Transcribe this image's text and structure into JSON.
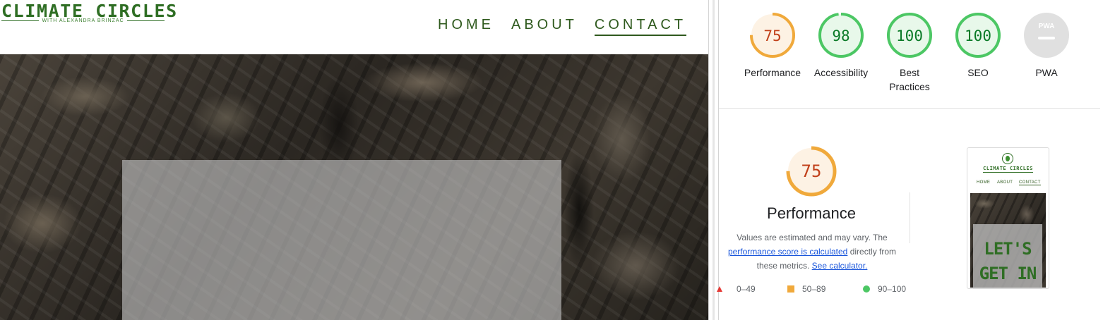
{
  "site": {
    "logo_title": "CLIMATE CIRCLES",
    "logo_subtitle": "WITH ALEXANDRA BRINZAC",
    "nav": {
      "home": "HOME",
      "about": "ABOUT",
      "contact": "CONTACT",
      "active": "contact"
    },
    "brand_color": "#2f6e24"
  },
  "report": {
    "scores": [
      {
        "label": "Performance",
        "value": "75",
        "status": "average"
      },
      {
        "label": "Accessibility",
        "value": "98",
        "status": "pass"
      },
      {
        "label": "Best Practices",
        "value": "100",
        "status": "pass"
      },
      {
        "label": "SEO",
        "value": "100",
        "status": "pass"
      },
      {
        "label": "PWA",
        "value": "",
        "status": "na"
      }
    ],
    "pwa_badge": "PWA",
    "performance": {
      "score": "75",
      "title": "Performance",
      "desc_1": "Values are estimated and may vary. The",
      "desc_link_1": "performance score is calculated",
      "desc_2": "directly from",
      "desc_3": "these metrics.",
      "desc_link_2": "See calculator."
    },
    "legend": [
      {
        "range": "0–49",
        "color": "#e53935",
        "shape": "triangle"
      },
      {
        "range": "50–89",
        "color": "#f0a93b",
        "shape": "square"
      },
      {
        "range": "90–100",
        "color": "#4cc764",
        "shape": "circle"
      }
    ],
    "colors": {
      "average": "#f0a93b",
      "average_text": "#c1401a",
      "pass": "#4cc764",
      "pass_text": "#0a7a27",
      "na": "#e0e0e0"
    },
    "thumbnail": {
      "title": "CLIMATE CIRCLES",
      "nav_home": "HOME",
      "nav_about": "ABOUT",
      "nav_contact": "CONTACT",
      "hero_line_1": "LET'S",
      "hero_line_2": "GET IN"
    }
  }
}
